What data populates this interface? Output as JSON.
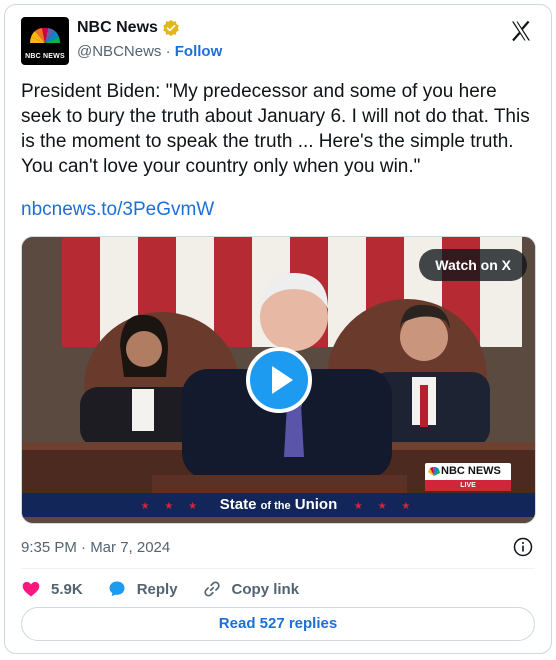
{
  "account": {
    "display_name": "NBC News",
    "handle": "@NBCNews",
    "separator": " · ",
    "follow_label": "Follow",
    "avatar_text": "NBC NEWS"
  },
  "tweet": {
    "text": "President Biden: \"My predecessor and some of you here seek to bury the truth about January 6. I will not do that. This is the moment to speak the truth ... Here's the simple truth. You can't love your country only when you win.\"",
    "link": "nbcnews.to/3PeGvmW"
  },
  "media": {
    "watch_label": "Watch on X",
    "chyron_pre": "State ",
    "chyron_small": "of the",
    "chyron_post": " Union",
    "chyron_stars": "★ ★ ★",
    "bug_brand": "NBC NEWS",
    "bug_live": "LIVE"
  },
  "footer": {
    "timestamp": "9:35 PM · Mar 7, 2024",
    "likes": "5.9K",
    "reply_label": "Reply",
    "copy_link_label": "Copy link",
    "read_replies_label": "Read 527 replies"
  },
  "colors": {
    "accent": "#1d6fd8",
    "play_button": "#1d9bf0",
    "like_heart": "#f91880",
    "verified_badge": "#e2b719"
  },
  "icons": {
    "verified": "verified-badge-icon",
    "brand": "x-logo-icon",
    "info": "info-icon",
    "like": "heart-icon",
    "reply": "speech-bubble-icon",
    "copy": "link-icon",
    "play": "play-icon"
  }
}
